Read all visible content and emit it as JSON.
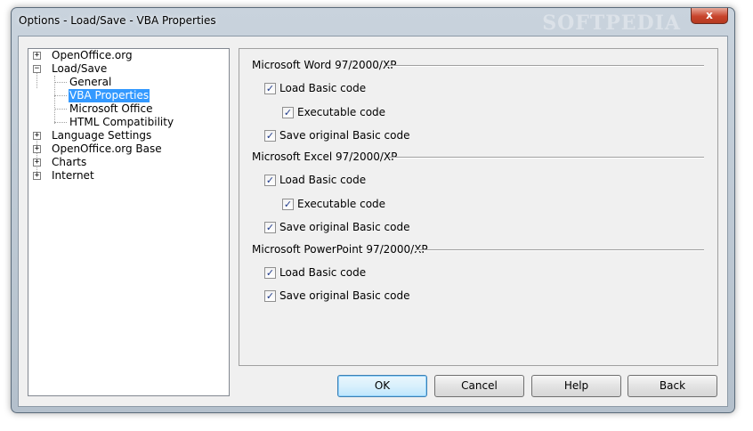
{
  "window": {
    "title": "Options - Load/Save - VBA Properties",
    "close_label": "x",
    "watermark": "SOFTPEDIA"
  },
  "tree": {
    "items": [
      {
        "label": "OpenOffice.org",
        "expander": "+"
      },
      {
        "label": "Load/Save",
        "expander": "−"
      },
      {
        "label": "General"
      },
      {
        "label": "VBA Properties",
        "selected": true
      },
      {
        "label": "Microsoft Office"
      },
      {
        "label": "HTML Compatibility"
      },
      {
        "label": "Language Settings",
        "expander": "+"
      },
      {
        "label": "OpenOffice.org Base",
        "expander": "+"
      },
      {
        "label": "Charts",
        "expander": "+"
      },
      {
        "label": "Internet",
        "expander": "+"
      }
    ]
  },
  "groups": [
    {
      "title": "Microsoft Word 97/2000/XP",
      "options": [
        {
          "label": "Load Basic code",
          "checked": true
        },
        {
          "label": "Executable code",
          "checked": true
        },
        {
          "label": "Save original Basic code",
          "checked": true
        }
      ]
    },
    {
      "title": "Microsoft Excel 97/2000/XP",
      "options": [
        {
          "label": "Load Basic code",
          "checked": true
        },
        {
          "label": "Executable code",
          "checked": true
        },
        {
          "label": "Save original Basic code",
          "checked": true
        }
      ]
    },
    {
      "title": "Microsoft PowerPoint 97/2000/XP",
      "options": [
        {
          "label": "Load Basic code",
          "checked": true
        },
        {
          "label": "Save original Basic code",
          "checked": true
        }
      ]
    }
  ],
  "check_glyph": "✓",
  "buttons": {
    "ok": "OK",
    "cancel": "Cancel",
    "help": "Help",
    "back": "Back"
  }
}
